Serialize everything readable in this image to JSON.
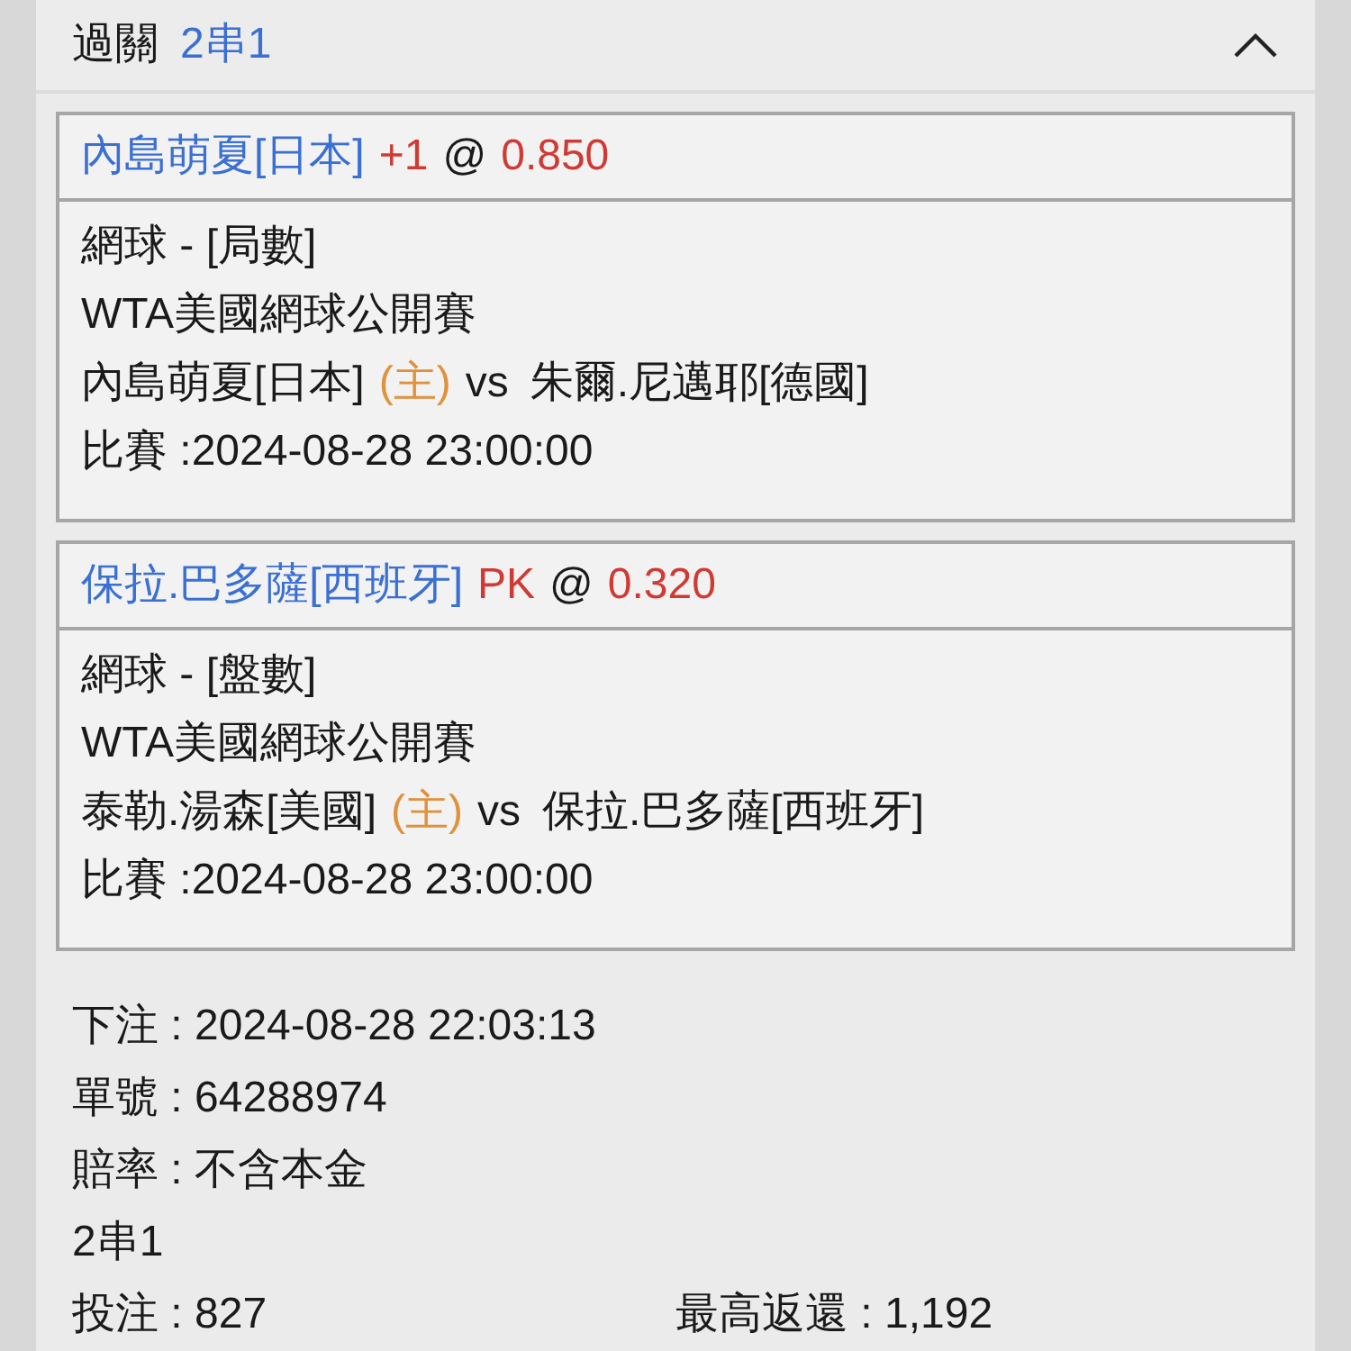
{
  "header": {
    "title": "過關",
    "bet_type": "2串1",
    "expanded": true
  },
  "legs": [
    {
      "selection": "內島萌夏[日本]",
      "handicap": "+1",
      "at": "@",
      "odds": "0.850",
      "market": "網球 - [局數]",
      "league": "WTA美國網球公開賽",
      "home": "內島萌夏[日本]",
      "home_tag": "(主)",
      "vs": "vs",
      "away": "朱爾.尼邁耶[德國]",
      "match_time": "比賽 :2024-08-28 23:00:00"
    },
    {
      "selection": "保拉.巴多薩[西班牙]",
      "handicap": "PK",
      "at": "@",
      "odds": "0.320",
      "market": "網球 - [盤數]",
      "league": "WTA美國網球公開賽",
      "home": "泰勒.湯森[美國]",
      "home_tag": "(主)",
      "vs": "vs",
      "away": "保拉.巴多薩[西班牙]",
      "match_time": "比賽 :2024-08-28 23:00:00"
    }
  ],
  "summary": {
    "placed": "下注 : 2024-08-28 22:03:13",
    "ticket": "單號 : 64288974",
    "odds_type": "賠率 : 不含本金",
    "combo": "2串1",
    "stake": "投注 : 827",
    "max_return": "最高返還 : 1,192"
  }
}
